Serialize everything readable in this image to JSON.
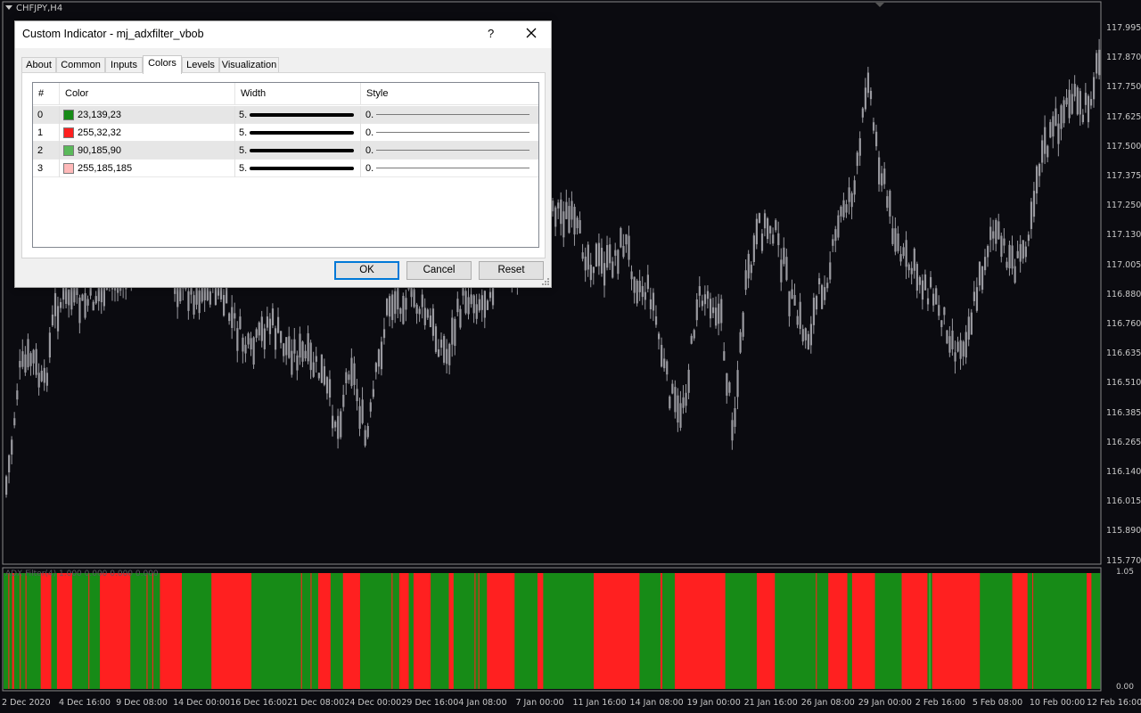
{
  "chart": {
    "title": "CHFJPY,H4",
    "subwindow_label": "ADX Filter(4) 1.000 0.000 0.000 0.000",
    "subwindow_scale_top": "1.05",
    "subwindow_scale_bottom": "0.00",
    "price_labels": [
      "117.995",
      "117.870",
      "117.750",
      "117.625",
      "117.500",
      "117.375",
      "117.250",
      "117.130",
      "117.005",
      "116.880",
      "116.760",
      "116.635",
      "116.510",
      "116.385",
      "116.265",
      "116.140",
      "116.015",
      "115.890",
      "115.770"
    ],
    "time_labels": [
      "2 Dec 2020",
      "4 Dec 16:00",
      "9 Dec 08:00",
      "14 Dec 00:00",
      "16 Dec 16:00",
      "21 Dec 08:00",
      "24 Dec 00:00",
      "29 Dec 16:00",
      "4 Jan 08:00",
      "7 Jan 00:00",
      "11 Jan 16:00",
      "14 Jan 08:00",
      "19 Jan 00:00",
      "21 Jan 16:00",
      "26 Jan 08:00",
      "29 Jan 00:00",
      "2 Feb 16:00",
      "5 Feb 08:00",
      "10 Feb 00:00",
      "12 Feb 16:00"
    ],
    "colors": {
      "background": "#0b0b10",
      "candle": "#9a9aa0",
      "green": "#178b17",
      "red": "#ff2020",
      "light_green": "#5ab95a"
    },
    "adx_sequence": "GGGGGRGGGRRGGGGGGRGGGGGRGGGGGGGGGGGGGGGRRRRRRRRRRRGGGGGGRRRRRRRRRRRRRRRRGGGGGGGGGGGGGGGGGRGGGGGGGGGGGRRRRRRRRRRRRRRRRRRRRRRRRRRRRRRRRGGGGGGGGGGGGGGGGGRGGGGGRGGGGGGGRRRRRRRRRRRRRRRRRRRRRRRGGGGGGGGGGGGGGGGGGGGGGGGGGGGGGGRRRRRRRRRRRRRRRRRRRRRRRRRRRRRRRRRRRRRRRRRRGGGGGGGGGGGGGGGGGGGGGGGGGGGGGGGGGGGGGGGGGGGGGGGGGGGGRGGGGGGGGGRGGGGGGGRRRRRRRRRRRRRGGGGGGGGGGGGGRRRRRRRRRRRRRRRRRRGGGGGGGGGGGGGGGGGGGGGGGGGGGGGGGGGRGGGGGGGRRRRRRRRRRGGGGGRRRRRRRRRRRRRRRRRRGGGGGGGGGGGGGGGGGGGRRRRRGGGGGGGGGGGGGGGGGGGGGGRGGGRGGGGGGGGRRRRRRRRRRRRRRRRRRRRRRRRRRRRRGGGGGGGGGGGGGGGGGGGGGGGGRRRRRRGGGGGGGGGGGGGGGGGGGGGGGGGGGGGGGGGGGGGGGGGGGGGGGGGGGGGRRRRRRRRRRRRRRRRRRRRRRRRRRRRRRRRRRRRRRRRRRRRRRRRGGGGGGGGGGGGGGGGGGGGGGRRGGGGGGGGGGGGGRRRRRRRRRRRRRRRRRRRRRRRRRRRRRRRRRRRRRRRRRRRRRRRRRRRRRGGGGGGGGGGGGGGGGGGGGGGGGGGGGGGGGGRRRRRRRRRRRRRRRRRRRGGGGGGGGGGGGGGGGGGGGGGGGGGGGGGGGGGGGGGGGGGGRGGGGGGGGGGGGRRRRRRRRRRRRRRRRRRRRGGGGGRRRRRRRRRRRRRRRRRRRRRRRRGGGGGGGGGGGGGGGGGGGGGGGGGGGGRRRRRRRRRRRRRRRRRRRRRRRRRRRGGLGGRRRRRRRRRRRRRRRRRRRRRRRRRRRRRRRRRRRRRRRRRRRRRRRRRRGGGGGGGGGGGGGGGGGGGGGGGGGGGGGGGGGGRRRRRRRRRRRRRRRRGGGGGRGGGGGGGGGGGGGGGGGGGGGGGGGGGGGGGGGGGGGGGGGGGGGGGGGGGGGGGGRRRRRGGGGGGGGG"
  },
  "dialog": {
    "title": "Custom Indicator - mj_adxfilter_vbob",
    "help": "?",
    "tabs": [
      "About",
      "Common",
      "Inputs",
      "Colors",
      "Levels",
      "Visualization"
    ],
    "active_tab": "Colors",
    "columns": [
      "#",
      "Color",
      "Width",
      "Style"
    ],
    "rows": [
      {
        "index": "0",
        "color_hex": "#178b17",
        "color_text": "23,139,23",
        "width": "5.",
        "style": "0."
      },
      {
        "index": "1",
        "color_hex": "#ff2020",
        "color_text": "255,32,32",
        "width": "5.",
        "style": "0."
      },
      {
        "index": "2",
        "color_hex": "#5ab95a",
        "color_text": "90,185,90",
        "width": "5.",
        "style": "0."
      },
      {
        "index": "3",
        "color_hex": "#ffb9b9",
        "color_text": "255,185,185",
        "width": "5.",
        "style": "0."
      }
    ],
    "buttons": {
      "ok": "OK",
      "cancel": "Cancel",
      "reset": "Reset"
    }
  }
}
